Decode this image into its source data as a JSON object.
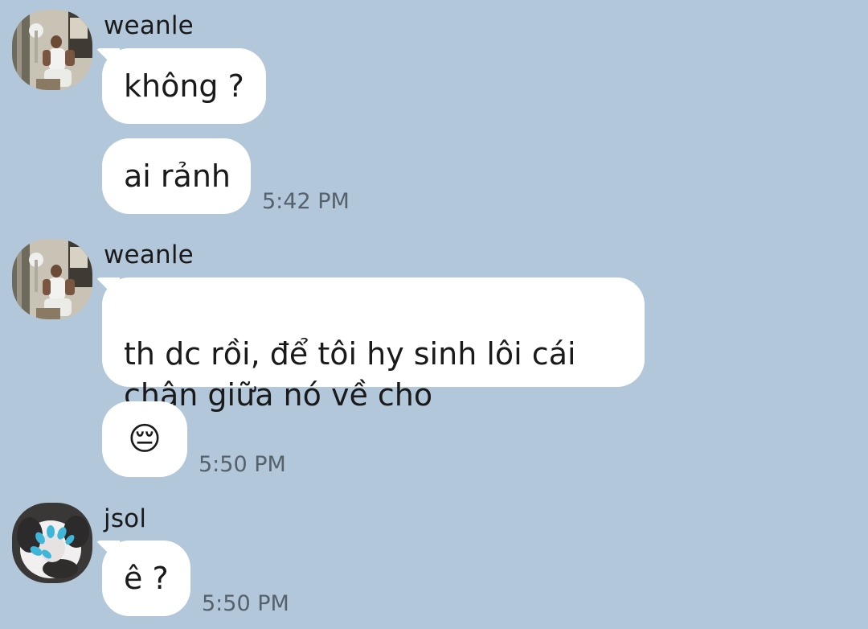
{
  "messages": {
    "g1": {
      "sender": "weanle",
      "bubbles": [
        "không ?",
        "ai rảnh"
      ],
      "time": "5:42 PM"
    },
    "g2": {
      "sender": "weanle",
      "bubbles": [
        "th dc rồi, để tôi hy sinh lôi cái\nchân giữa nó về cho",
        "😔"
      ],
      "time": "5:50 PM"
    },
    "g3": {
      "sender": "jsol",
      "bubbles": [
        "ê ?"
      ],
      "time": "5:50 PM"
    }
  },
  "colors": {
    "background": "#b2c7da",
    "bubble": "#ffffff",
    "timestamp": "#55616b"
  }
}
